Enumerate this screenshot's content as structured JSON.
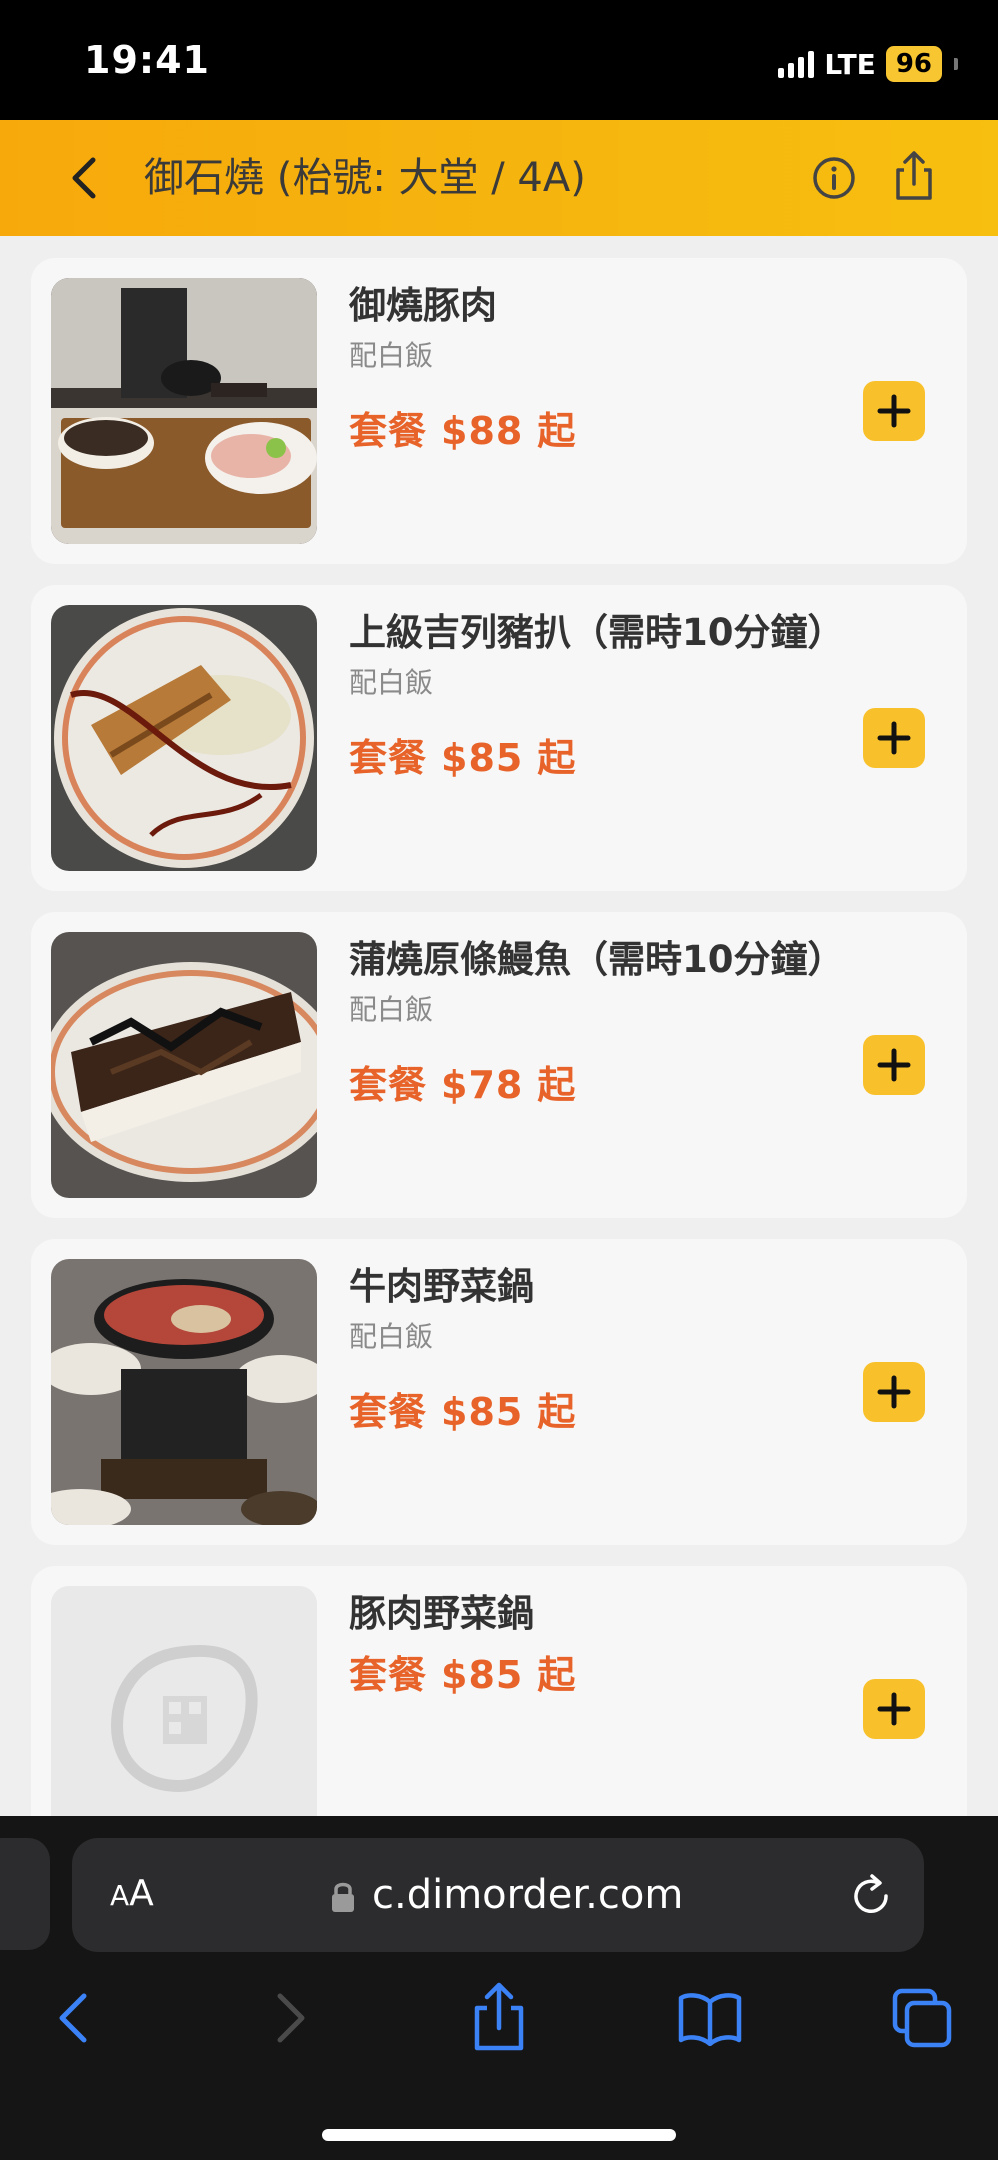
{
  "status_bar": {
    "time": "19:41",
    "network": "LTE",
    "battery": "96"
  },
  "header": {
    "title": "御石燒 (枱號: 大堂 / 4A)",
    "back_icon": "chevron-left-icon",
    "info_icon": "info-circle-icon",
    "share_icon": "share-icon",
    "gradient": [
      "#f7a90b",
      "#f7bf0f"
    ]
  },
  "menu_items": [
    {
      "name": "御燒豚肉",
      "desc": "配白飯",
      "price_prefix": "套餐",
      "price": "$88",
      "price_suffix": "起",
      "image": "pork-set-photo"
    },
    {
      "name": "上級吉列豬扒（需時10分鐘）",
      "desc": "配白飯",
      "price_prefix": "套餐",
      "price": "$85",
      "price_suffix": "起",
      "image": "pork-cutlet-photo"
    },
    {
      "name": "蒲燒原條鰻魚（需時10分鐘）",
      "desc": "配白飯",
      "price_prefix": "套餐",
      "price": "$78",
      "price_suffix": "起",
      "image": "eel-photo"
    },
    {
      "name": "牛肉野菜鍋",
      "desc": "配白飯",
      "price_prefix": "套餐",
      "price": "$85",
      "price_suffix": "起",
      "image": "beef-hotpot-photo"
    },
    {
      "name": "豚肉野菜鍋",
      "desc": "",
      "price_prefix": "套餐",
      "price": "$85",
      "price_suffix": "起",
      "image": "placeholder-logo"
    }
  ],
  "colors": {
    "accent": "#f8c12c",
    "price": "#e7632a",
    "ios_blue": "#3b82f6"
  },
  "browser": {
    "aa_small": "A",
    "aa_large": "A",
    "url": "c.dimorder.com",
    "icons": [
      "back-icon",
      "forward-icon",
      "share-icon",
      "bookmarks-icon",
      "tabs-icon"
    ]
  }
}
